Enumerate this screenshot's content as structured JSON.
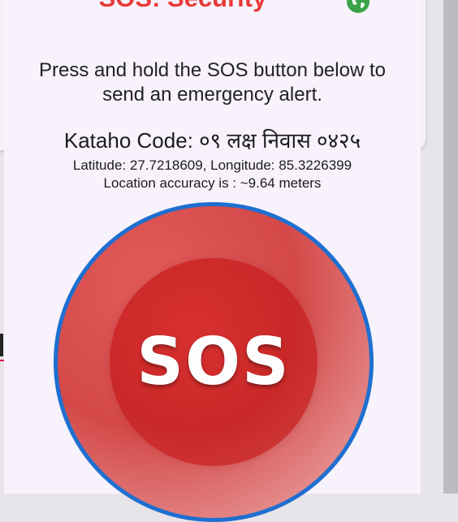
{
  "dialog": {
    "title": "SOS: Security",
    "instructions": "Press and hold the SOS button below to send an emergency alert.",
    "kataho_code": "Kataho Code: ०९ लक्ष निवास ०४२५",
    "latlng": "Latitude: 27.7218609, Longitude: 85.3226399",
    "accuracy": "Location accuracy is : ~9.64 meters",
    "sos_label": "SOS",
    "icon": "globe-icon"
  },
  "colors": {
    "title": "#e83a3a",
    "sos_red": "#d44848",
    "ring_blue": "#1e6fd0",
    "sheet_bg": "#f7f2fb",
    "accent_line": "#e5164f",
    "globe_green": "#3aa34a"
  }
}
